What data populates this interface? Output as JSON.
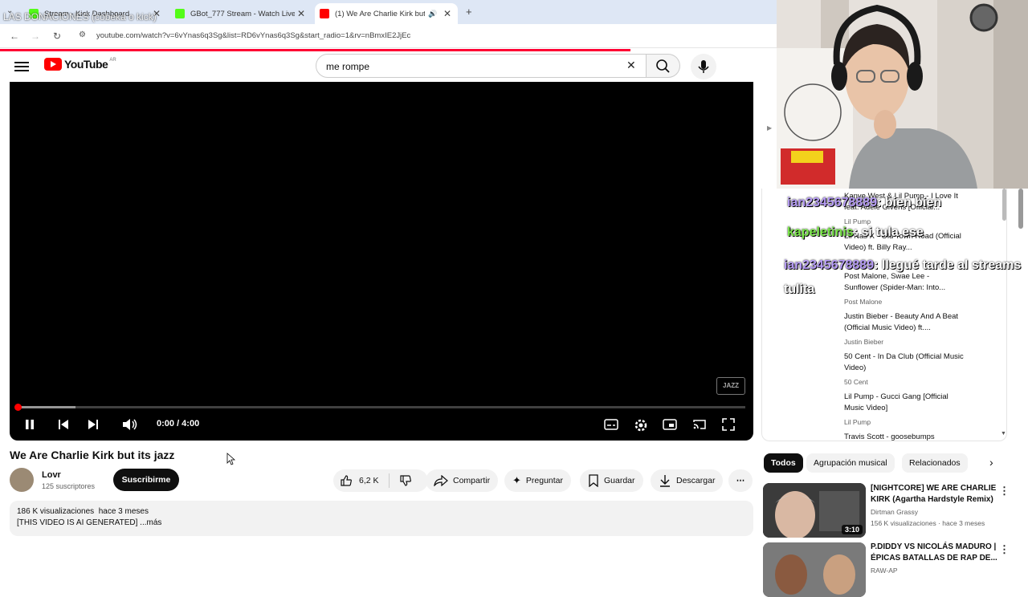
{
  "tabs": [
    {
      "title": "Stream - Kick Dashboard",
      "favicon_color": "#53fc18",
      "active": false
    },
    {
      "title": "GBot_777 Stream - Watch Live o",
      "favicon_color": "#53fc18",
      "active": false
    },
    {
      "title": "(1) We Are Charlie Kirk but",
      "favicon_color": "#ff0000",
      "active": true
    }
  ],
  "new_tab_label": "+",
  "url": "youtube.com/watch?v=6vYnas6q3Sg&list=RD6vYnas6q3Sg&start_radio=1&rv=nBmxIE2JjEc",
  "overlay_text": "LAS DONACIONES (cobeka o kick)",
  "header": {
    "logo_text": "YouTube",
    "logo_suffix": "AR",
    "search_value": "me rompe"
  },
  "player": {
    "time": "0:00 / 4:00",
    "progress": 0.0,
    "buffered": 0.08,
    "watermark": "JAZZ"
  },
  "video": {
    "title": "We Are Charlie Kirk but its jazz",
    "channel": "Lovr",
    "subscribers": "125 suscriptores",
    "subscribe_label": "Suscribirme",
    "likes": "6,2 K",
    "share_label": "Compartir",
    "ask_label": "Preguntar",
    "save_label": "Guardar",
    "download_label": "Descargar",
    "views_line": "186 K visualizaciones  hace 3 meses",
    "description": "[THIS VIDEO IS AI GENERATED] ...más"
  },
  "queue": [
    {
      "title": "Kanye West & Lil Pump - I Love It feat. Adele Givens [Official...",
      "channel": "Lil Pump"
    },
    {
      "title": "Lil Nas X - Old Town Road (Official Video) ft. Billy Ray...",
      "channel": ""
    },
    {
      "title": "Post Malone, Swae Lee - Sunflower (Spider-Man: Into...",
      "channel": "Post Malone"
    },
    {
      "title": "Justin Bieber - Beauty And A Beat (Official Music Video) ft....",
      "channel": "Justin Bieber"
    },
    {
      "title": "50 Cent - In Da Club (Official Music Video)",
      "channel": "50 Cent"
    },
    {
      "title": "Lil Pump - Gucci Gang [Official Music Video]",
      "channel": "Lil Pump"
    },
    {
      "title": "Travis Scott - goosebumps",
      "channel": ""
    }
  ],
  "chat": [
    {
      "user": "ian2345678889",
      "message": ": bien bien",
      "color": "#b69cf5"
    },
    {
      "user": "kapeletinis",
      "message": ": si tula ese",
      "color": "#7be84a"
    },
    {
      "user": "ian2345678889",
      "message": ": llegué tarde al streams tulita",
      "color": "#b69cf5"
    }
  ],
  "chips": [
    "Todos",
    "Agrupación musical",
    "Relacionados"
  ],
  "recommendations": [
    {
      "title": "[NIGHTCORE] WE ARE CHARLIE KIRK (Agartha Hardstyle Remix)",
      "channel": "Dirtman Grassy",
      "meta": "156 K visualizaciones · hace 3 meses",
      "duration": "3:10"
    },
    {
      "title": "P.DIDDY VS NICOLÁS MADURO | ÉPICAS BATALLAS DE RAP DE...",
      "channel": "RAW-AP",
      "meta": "",
      "duration": ""
    }
  ]
}
